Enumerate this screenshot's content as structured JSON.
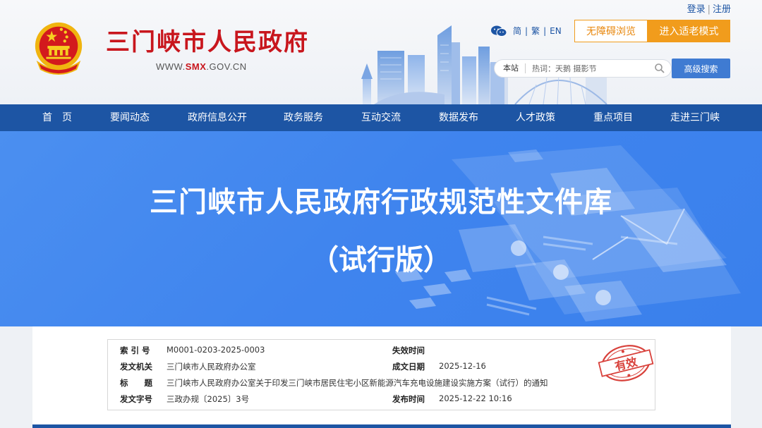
{
  "header": {
    "site_name": "三门峡市人民政府",
    "site_url_prefix": "WWW.",
    "site_url_highlight": "SMX",
    "site_url_suffix": ".GOV.CN",
    "login_label": "登录",
    "register_label": "注册",
    "lang_simplified": "简",
    "lang_traditional": "繁",
    "lang_english": "EN",
    "accessibility_label": "无障碍浏览",
    "elder_mode_label": "进入适老模式",
    "search_scope": "本站",
    "search_placeholder": "热词：天鹅 摄影节",
    "advanced_search_label": "高级搜索"
  },
  "nav": {
    "items": [
      "首　页",
      "要闻动态",
      "政府信息公开",
      "政务服务",
      "互动交流",
      "数据发布",
      "人才政策",
      "重点项目",
      "走进三门峡"
    ]
  },
  "banner": {
    "title": "三门峡市人民政府行政规范性文件库",
    "subtitle": "（试行版）"
  },
  "doc_info": {
    "index_label": "索 引 号",
    "index_value": "M0001-0203-2025-0003",
    "expire_label": "失效时间",
    "expire_value": "",
    "issuer_label": "发文机关",
    "issuer_value": "三门峡市人民政府办公室",
    "created_label": "成文日期",
    "created_value": "2025-12-16",
    "title_label": "标　　题",
    "title_value": "三门峡市人民政府办公室关于印发三门峡市居民住宅小区新能源汽车充电设施建设实施方案（试行）的通知",
    "docno_label": "发文字号",
    "docno_value": "三政办规〔2025〕3号",
    "published_label": "发布时间",
    "published_value": "2025-12-22 10:16",
    "status_stamp": "有效"
  },
  "colors": {
    "brand_red": "#c8161d",
    "nav_blue": "#1d55a4",
    "accent_orange": "#f19c1c",
    "banner_blue": "#4189ee"
  }
}
